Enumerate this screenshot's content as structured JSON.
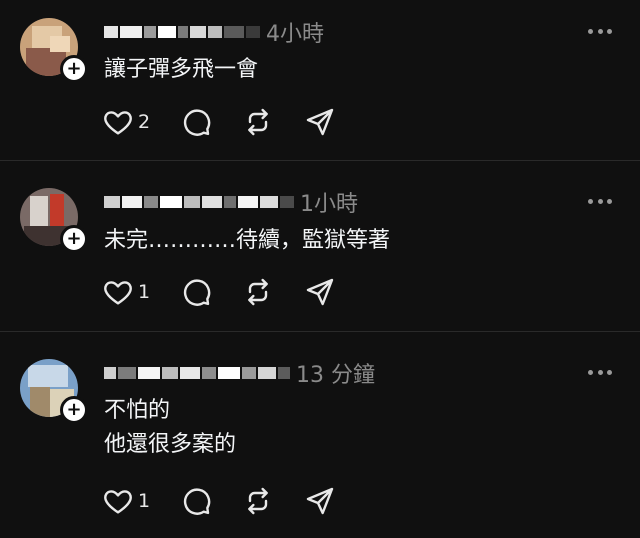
{
  "posts": [
    {
      "time": "4小時",
      "lines": [
        "讓子彈多飛一會"
      ],
      "likes": "2",
      "avatar_colors": [
        "#c9a27a",
        "#e4c9a6",
        "#8a5a4a",
        "#efd7b8"
      ]
    },
    {
      "time": "1小時",
      "lines": [
        "未完…………待續，監獄等著"
      ],
      "likes": "1",
      "avatar_colors": [
        "#7a6a66",
        "#c23a2a",
        "#d8d2cc",
        "#3e3230"
      ]
    },
    {
      "time": "13 分鐘",
      "lines": [
        "不怕的",
        "他還很多案的"
      ],
      "likes": "1",
      "avatar_colors": [
        "#7aa0c8",
        "#c8d8e8",
        "#a08a6a",
        "#dcd2b8"
      ]
    }
  ],
  "icons": {
    "like": "heart-icon",
    "comment": "comment-bubble-icon",
    "repost": "repost-icon",
    "share": "send-icon",
    "more": "more-dots-icon",
    "follow": "plus-icon"
  }
}
